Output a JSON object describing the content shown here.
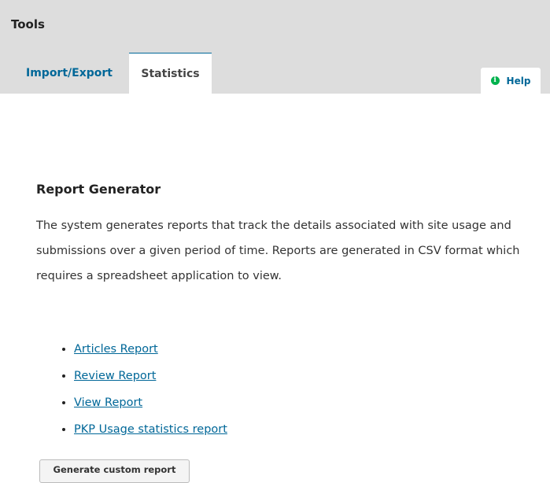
{
  "header": {
    "title": "Tools",
    "tabs": [
      {
        "label": "Import/Export",
        "active": false
      },
      {
        "label": "Statistics",
        "active": true
      }
    ],
    "help": {
      "label": "Help",
      "icon": "info-icon"
    }
  },
  "report_generator": {
    "heading": "Report Generator",
    "description": "The system generates reports that track the details associated with site usage and submissions over a given period of time. Reports are generated in CSV format which requires a spreadsheet application to view.",
    "reports": [
      {
        "label": "Articles Report"
      },
      {
        "label": "Review Report"
      },
      {
        "label": "View Report"
      },
      {
        "label": "PKP Usage statistics report"
      }
    ],
    "custom_button": "Generate custom report"
  },
  "colors": {
    "link": "#006798",
    "header_bg": "#dddddd",
    "help_icon": "#00b24e"
  }
}
